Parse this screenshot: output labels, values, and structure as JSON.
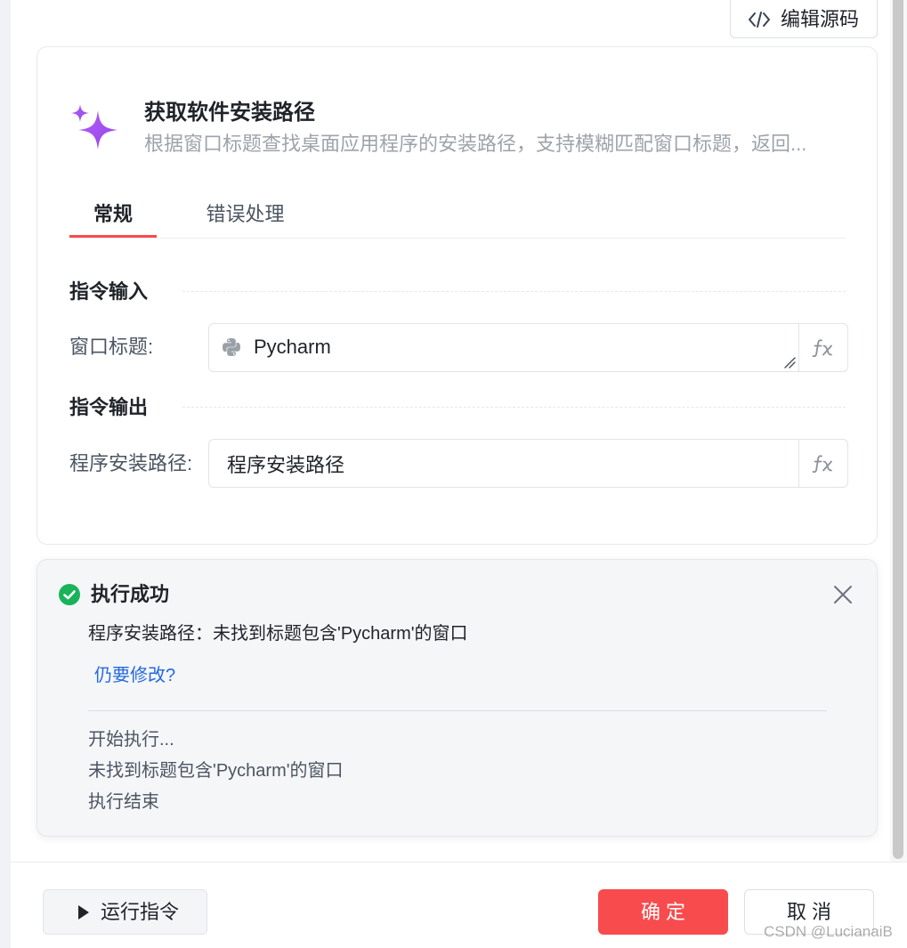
{
  "toolbar": {
    "edit_source_label": "编辑源码",
    "edit_source_icon": "code-icon"
  },
  "command": {
    "icon": "sparkle-icon",
    "title": "获取软件安装路径",
    "description": "根据窗口标题查找桌面应用程序的安装路径，支持模糊匹配窗口标题，返回..."
  },
  "tabs": [
    {
      "label": "常规",
      "active": true
    },
    {
      "label": "错误处理",
      "active": false
    }
  ],
  "input_section": {
    "heading": "指令输入",
    "fields": [
      {
        "label": "窗口标题:",
        "value": "Pycharm",
        "icon": "python-icon",
        "action_icon": "function-icon"
      }
    ]
  },
  "output_section": {
    "heading": "指令输出",
    "fields": [
      {
        "label": "程序安装路径:",
        "value": "程序安装路径",
        "action_icon": "function-icon"
      }
    ]
  },
  "result": {
    "status_icon": "check-circle-icon",
    "title": "执行成功",
    "message": "程序安装路径：未找到标题包含'Pycharm'的窗口",
    "edit_link": "仍要修改?",
    "log": [
      "开始执行...",
      "未找到标题包含'Pycharm'的窗口",
      "执行结束"
    ]
  },
  "footer": {
    "run_icon": "play-icon",
    "run_label": "运行指令",
    "confirm_label": "确 定",
    "cancel_label": "取 消"
  },
  "watermark": "CSDN @LucianaiB",
  "colors": {
    "accent_red": "#f84b4e",
    "success_green": "#19b35a",
    "link_blue": "#2468e0",
    "sparkle_purple": "#a553f2"
  }
}
